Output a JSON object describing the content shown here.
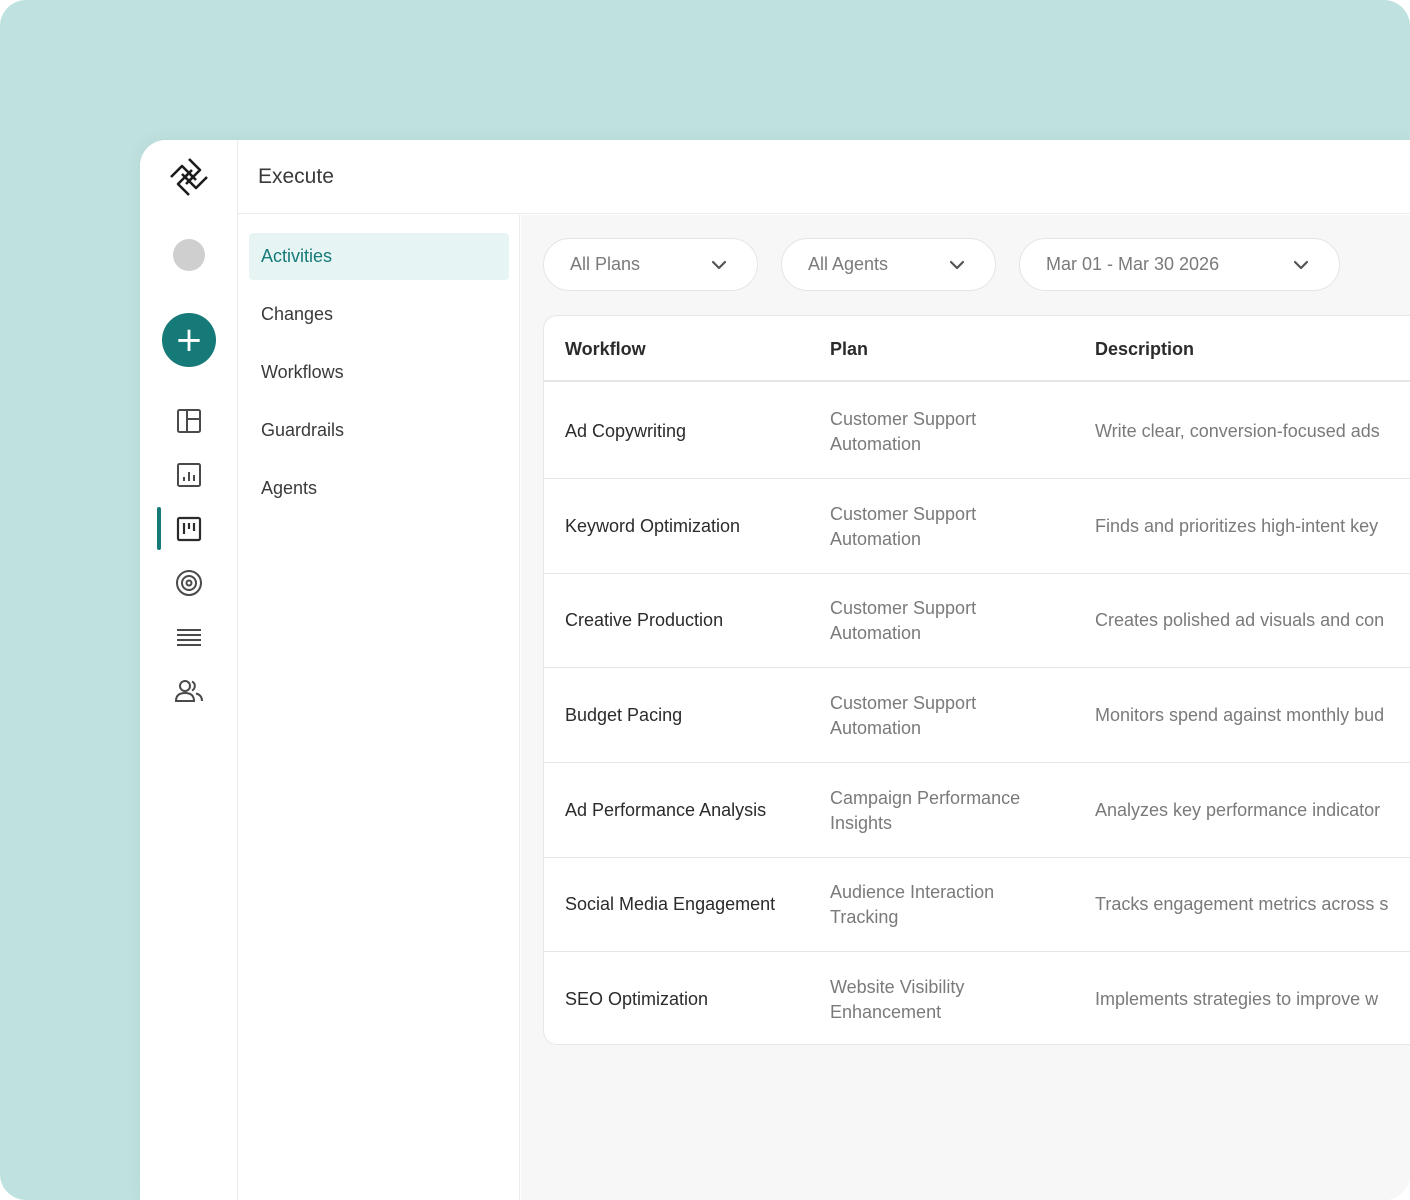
{
  "header": {
    "title": "Execute"
  },
  "rail": {
    "icons": [
      "logo-icon",
      "avatar",
      "add-icon",
      "layout-icon",
      "chart-icon",
      "board-icon",
      "target-icon",
      "list-icon",
      "users-icon"
    ],
    "add_label": "+",
    "accent": "#157a78"
  },
  "subnav": {
    "items": [
      {
        "label": "Activities",
        "active": true
      },
      {
        "label": "Changes"
      },
      {
        "label": "Workflows"
      },
      {
        "label": "Guardrails"
      },
      {
        "label": "Agents"
      }
    ]
  },
  "filters": {
    "plans": "All Plans",
    "agents": "All Agents",
    "dates": "Mar 01 - Mar 30 2026"
  },
  "table": {
    "columns": [
      "Workflow",
      "Plan",
      "Description"
    ],
    "rows": [
      {
        "workflow": "Ad Copywriting",
        "plan": "Customer Support Automation",
        "description": "Write clear, conversion-focused ads"
      },
      {
        "workflow": "Keyword Optimization",
        "plan": "Customer Support Automation",
        "description": "Finds and prioritizes high-intent key"
      },
      {
        "workflow": "Creative Production",
        "plan": "Customer Support Automation",
        "description": "Creates polished ad visuals and con"
      },
      {
        "workflow": "Budget Pacing",
        "plan": "Customer Support Automation",
        "description": "Monitors spend against monthly bud"
      },
      {
        "workflow": "Ad Performance Analysis",
        "plan": "Campaign Performance Insights",
        "description": "Analyzes key performance indicator"
      },
      {
        "workflow": "Social Media Engagement",
        "plan": "Audience Interaction Tracking",
        "description": "Tracks engagement metrics across s"
      },
      {
        "workflow": "SEO Optimization",
        "plan": "Website Visibility Enhancement",
        "description": "Implements strategies to improve w"
      }
    ]
  }
}
